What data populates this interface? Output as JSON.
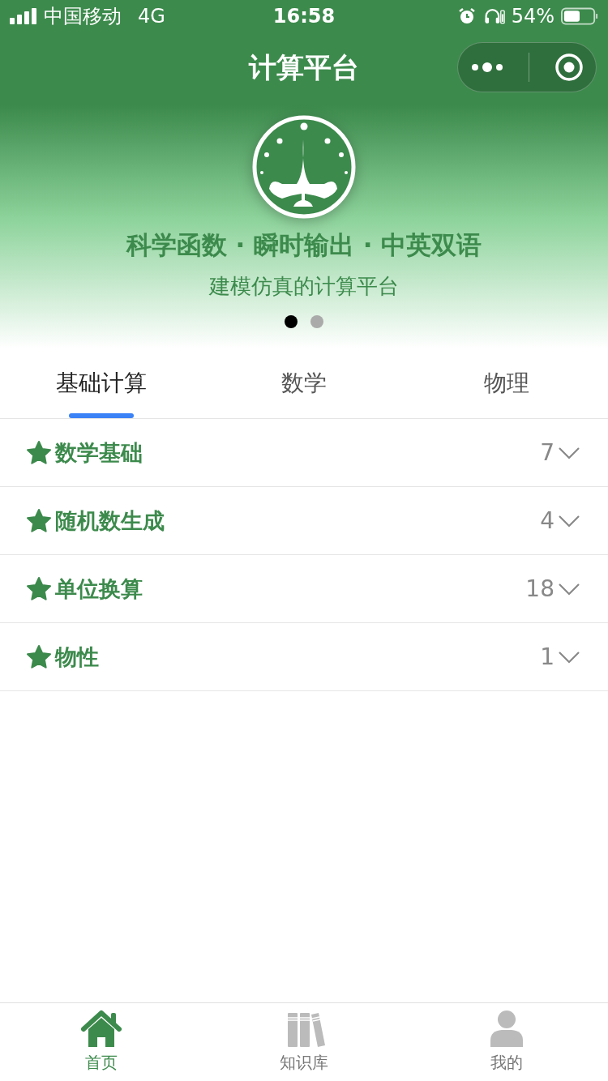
{
  "status_bar": {
    "carrier": "中国移动",
    "network": "4G",
    "time": "16:58",
    "battery": "54%"
  },
  "nav": {
    "title": "计算平台"
  },
  "hero": {
    "headline": "科学函数 · 瞬时输出 · 中英双语",
    "subtitle": "建模仿真的计算平台",
    "dots": [
      {
        "selected": true
      },
      {
        "selected": false
      }
    ]
  },
  "tabs": [
    {
      "label": "基础计算",
      "selected": true
    },
    {
      "label": "数学",
      "selected": false
    },
    {
      "label": "物理",
      "selected": false
    }
  ],
  "categories": [
    {
      "name": "数学基础",
      "count": "7",
      "expanded": false
    },
    {
      "name": "随机数生成",
      "count": "4",
      "expanded": false
    },
    {
      "name": "单位换算",
      "count": "18",
      "expanded": false
    },
    {
      "name": "物性",
      "count": "1",
      "expanded": false
    }
  ],
  "tab_bar": [
    {
      "label": "首页",
      "kind": "home",
      "selected": true
    },
    {
      "label": "知识库",
      "kind": "books",
      "selected": false
    },
    {
      "label": "我的",
      "kind": "user",
      "selected": false
    }
  ]
}
